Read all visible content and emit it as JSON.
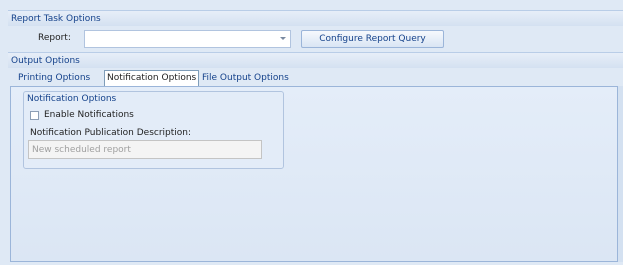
{
  "report_task": {
    "header": "Report Task Options",
    "report_label": "Report:",
    "report_value": "",
    "configure_button": "Configure Report Query"
  },
  "output": {
    "header": "Output Options",
    "tabs": [
      {
        "label": "Printing Options"
      },
      {
        "label": "Notification Options"
      },
      {
        "label": "File Output Options"
      }
    ],
    "notification": {
      "group_title": "Notification Options",
      "enable_label": "Enable Notifications",
      "enabled": false,
      "description_label": "Notification Publication Description:",
      "description_placeholder": "New scheduled report"
    }
  },
  "colors": {
    "background": "#dfe9f5",
    "text_accent": "#15428b"
  }
}
